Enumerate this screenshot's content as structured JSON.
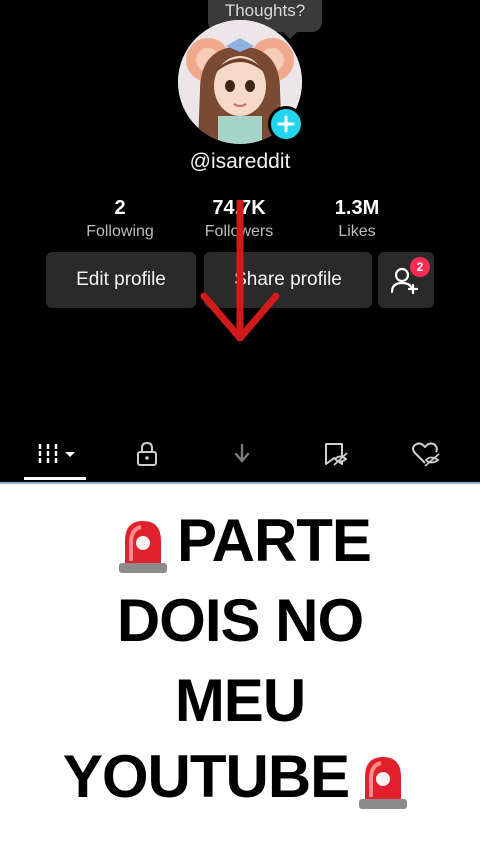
{
  "profile": {
    "thoughts_label": "Thoughts?",
    "username": "@isareddit",
    "stats": [
      {
        "value": "2",
        "label": "Following"
      },
      {
        "value": "74.7K",
        "label": "Followers"
      },
      {
        "value": "1.3M",
        "label": "Likes"
      }
    ],
    "edit_label": "Edit profile",
    "share_label": "Share profile",
    "friend_requests": "2"
  },
  "tabs": [
    "videos-grid",
    "private",
    "reposts",
    "favorites",
    "liked"
  ],
  "banner": {
    "line1": "PARTE",
    "line2": "DOIS NO",
    "line3": "MEU",
    "line4": "YOUTUBE"
  },
  "colors": {
    "accent": "#20d5ec",
    "badge": "#fe2c55",
    "arrow": "#d11a1a"
  }
}
